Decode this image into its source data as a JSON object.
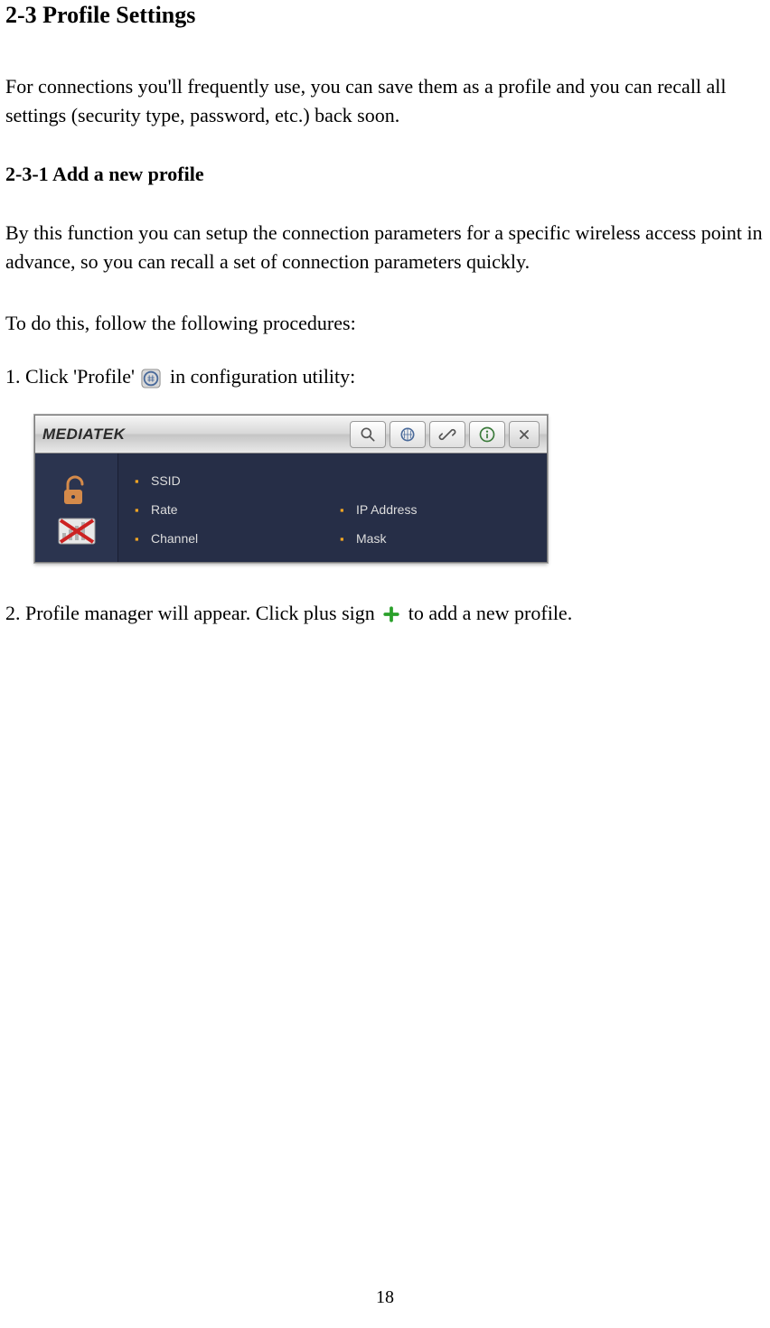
{
  "section_title": "2-3 Profile Settings",
  "intro": "For connections you'll frequently use, you can save them as a profile and you can recall all settings (security type, password, etc.) back soon.",
  "subsection_title": "2-3-1 Add a new profile",
  "sub_intro": "By this function you can setup the connection parameters for a specific wireless access point in advance, so you can recall a set of connection parameters quickly.",
  "proc_intro": "To do this, follow the following procedures:",
  "step1_pre": "1.  Click 'Profile' ",
  "step1_post": " in configuration utility:",
  "step2_pre": "2.  Profile manager will appear. Click plus sign ",
  "step2_post": " to add a new profile.",
  "panel": {
    "logo": "MEDIATEK",
    "fields": {
      "ssid": "SSID",
      "rate": "Rate",
      "channel": "Channel",
      "ip": "IP Address",
      "mask": "Mask"
    },
    "icons": {
      "search": "search-icon",
      "profile": "profile-icon",
      "link": "link-icon",
      "info": "info-icon",
      "close": "close-icon",
      "status": "no-signal-icon"
    }
  },
  "page_number": "18"
}
